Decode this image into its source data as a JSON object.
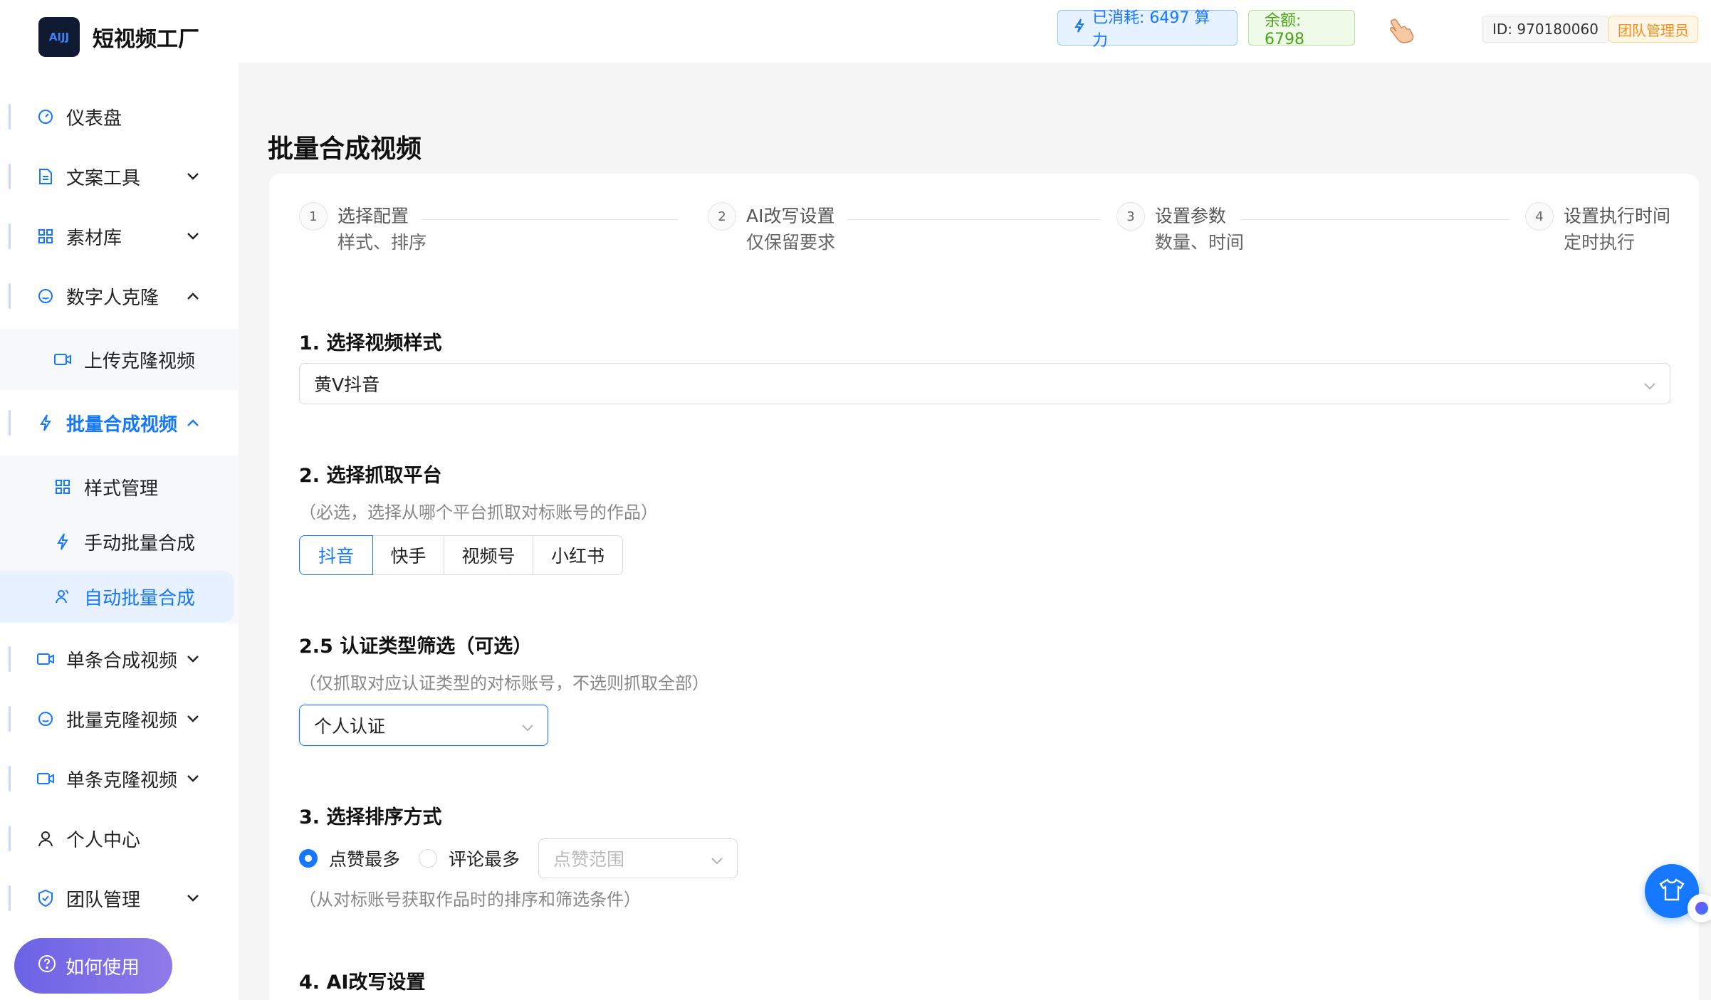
{
  "brand": {
    "logo_text": "AIJJ",
    "name": "短视频工厂"
  },
  "header": {
    "used_label": "已消耗: 6497 算力",
    "balance_label": "余额: 6798",
    "user_id": "ID: 970180060",
    "role": "团队管理员"
  },
  "sidebar": {
    "items": [
      {
        "label": "仪表盘"
      },
      {
        "label": "文案工具"
      },
      {
        "label": "素材库"
      },
      {
        "label": "数字人克隆"
      },
      {
        "label": "批量合成视频"
      },
      {
        "label": "单条合成视频"
      },
      {
        "label": "批量克隆视频"
      },
      {
        "label": "单条克隆视频"
      },
      {
        "label": "个人中心"
      },
      {
        "label": "团队管理"
      }
    ],
    "clone_sub": [
      {
        "label": "上传克隆视频"
      }
    ],
    "batch_sub": [
      {
        "label": "样式管理"
      },
      {
        "label": "手动批量合成"
      },
      {
        "label": "自动批量合成"
      }
    ],
    "help_label": "如何使用"
  },
  "main": {
    "title": "批量合成视频",
    "steps": [
      {
        "num": "1",
        "title": "选择配置",
        "desc": "样式、排序"
      },
      {
        "num": "2",
        "title": "AI改写设置",
        "desc": "仅保留要求"
      },
      {
        "num": "3",
        "title": "设置参数",
        "desc": "数量、时间"
      },
      {
        "num": "4",
        "title": "设置执行时间",
        "desc": "定时执行"
      }
    ],
    "sec1": {
      "title": "1. 选择视频样式",
      "value": "黄V抖音"
    },
    "sec2": {
      "title": "2. 选择抓取平台",
      "hint": "（必选，选择从哪个平台抓取对标账号的作品）",
      "platforms": [
        "抖音",
        "快手",
        "视频号",
        "小红书"
      ],
      "selected": "抖音"
    },
    "sec25": {
      "title": "2.5 认证类型筛选（可选）",
      "hint": "（仅抓取对应认证类型的对标账号，不选则抓取全部）",
      "value": "个人认证"
    },
    "sec3": {
      "title": "3. 选择排序方式",
      "options": [
        "点赞最多",
        "评论最多"
      ],
      "selected": "点赞最多",
      "range_placeholder": "点赞范围",
      "hint": "（从对标账号获取作品时的排序和筛选条件）"
    },
    "sec4": {
      "title": "4. AI改写设置"
    }
  },
  "colors": {
    "accent": "#1677ff",
    "balance": "#4aa31b",
    "role": "#fa8c16",
    "help_gradient": "#7b6ee7"
  }
}
